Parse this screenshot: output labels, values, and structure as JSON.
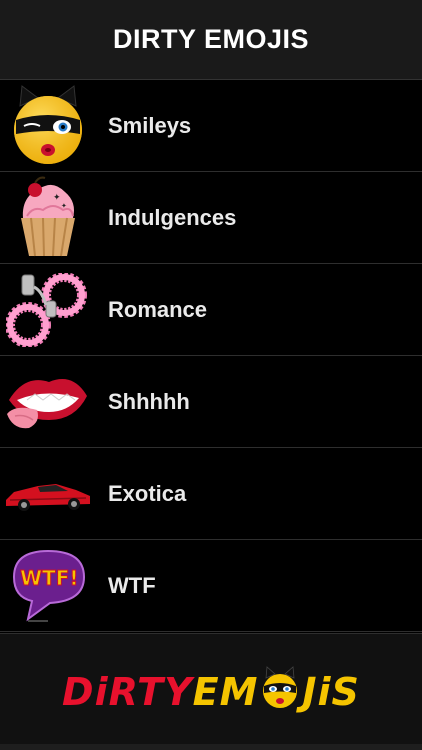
{
  "header": {
    "title": "DIRTY EMOJIS"
  },
  "categories": [
    {
      "label": "Smileys",
      "icon": "winking-cat-mask-face-icon"
    },
    {
      "label": "Indulgences",
      "icon": "cupcake-icon"
    },
    {
      "label": "Romance",
      "icon": "fluffy-handcuffs-icon"
    },
    {
      "label": "Shhhhh",
      "icon": "lips-tongue-icon"
    },
    {
      "label": "Exotica",
      "icon": "red-sports-car-icon"
    },
    {
      "label": "WTF",
      "icon": "wtf-speech-bubble-icon"
    }
  ],
  "footer": {
    "logo_text_part1": "DiRTY",
    "logo_text_part2": "EM",
    "logo_text_part3": "JiS",
    "logo_icon": "masked-face-logo-icon"
  },
  "colors": {
    "background": "#000000",
    "header_bg": "#1a1a1a",
    "label": "#eaeaea",
    "logo_red": "#e8112d",
    "logo_yellow": "#f5c400"
  }
}
